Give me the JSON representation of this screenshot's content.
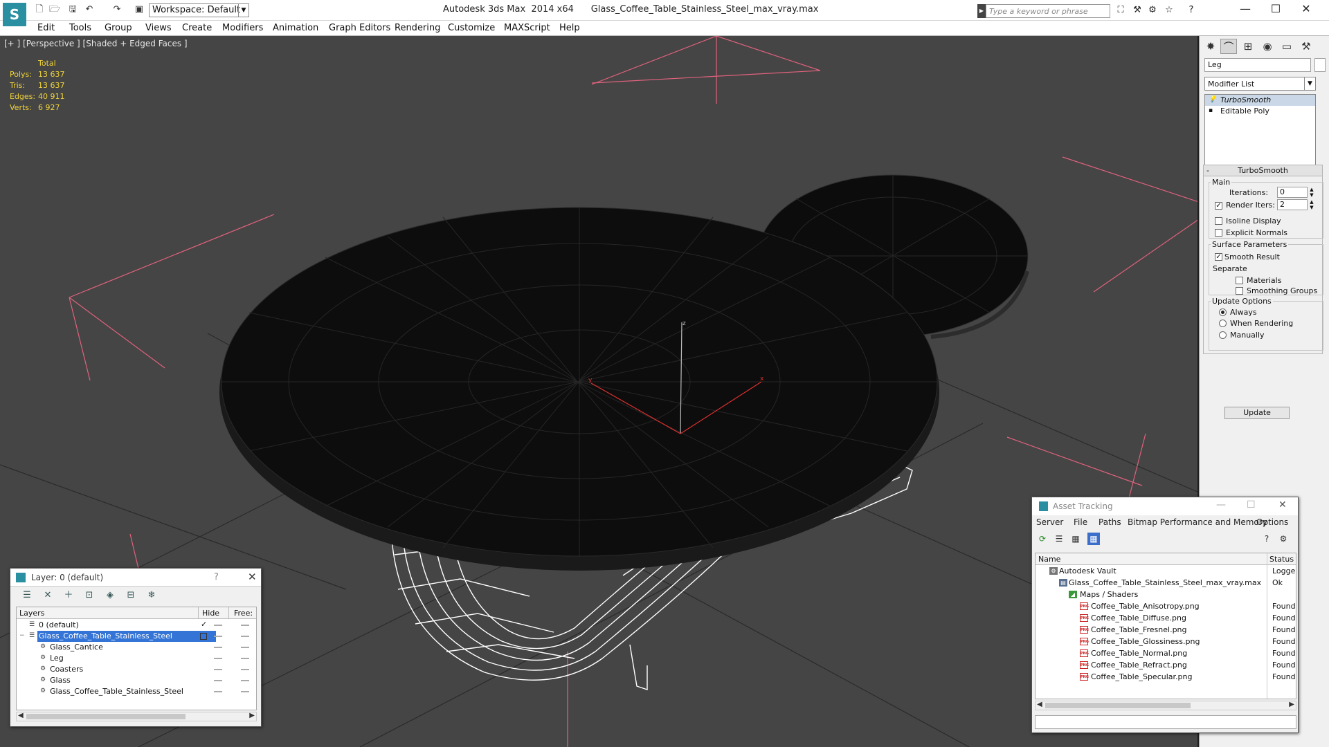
{
  "window": {
    "app_name": "Autodesk 3ds Max  2014 x64",
    "file_name": "Glass_Coffee_Table_Stainless_Steel_max_vray.max",
    "workspace": "Workspace: Default",
    "search_placeholder": "Type a keyword or phrase"
  },
  "menu": [
    "Edit",
    "Tools",
    "Group",
    "Views",
    "Create",
    "Modifiers",
    "Animation",
    "Graph Editors",
    "Rendering",
    "Customize",
    "MAXScript",
    "Help"
  ],
  "viewport": {
    "label": "[+ ] [Perspective ] [Shaded + Edged Faces ]",
    "stats_header": "Total",
    "stats": [
      {
        "label": "Polys:",
        "value": "13 637"
      },
      {
        "label": "Tris:",
        "value": "13 637"
      },
      {
        "label": "Edges:",
        "value": "40 911"
      },
      {
        "label": "Verts:",
        "value": "6 927"
      }
    ],
    "axis_labels": {
      "z": "z",
      "x": "x",
      "y": "y"
    }
  },
  "command_panel": {
    "object_name": "Leg",
    "modifier_list": "Modifier List",
    "stack": [
      {
        "label": "TurboSmooth",
        "selected": true
      },
      {
        "label": "Editable Poly",
        "selected": false
      }
    ],
    "turbosmooth": {
      "title": "TurboSmooth",
      "main_title": "Main",
      "iterations_label": "Iterations:",
      "iterations": "0",
      "render_iters_label": "Render Iters:",
      "render_iters": "2",
      "isoline": "Isoline Display",
      "explicit_normals": "Explicit Normals",
      "surface_title": "Surface Parameters",
      "smooth_result": "Smooth Result",
      "separate": "Separate",
      "materials": "Materials",
      "smoothing_groups": "Smoothing Groups",
      "update_title": "Update Options",
      "always": "Always",
      "when_rendering": "When Rendering",
      "manually": "Manually",
      "update_button": "Update"
    }
  },
  "layer_window": {
    "title": "Layer: 0 (default)",
    "help": "?",
    "columns": [
      "Layers",
      "Hide",
      "Free:"
    ],
    "rows": [
      {
        "name": "0 (default)",
        "level": 0,
        "selected": false
      },
      {
        "name": "Glass_Coffee_Table_Stainless_Steel",
        "level": 0,
        "selected": true
      },
      {
        "name": "Glass_Cantice",
        "level": 1,
        "selected": false
      },
      {
        "name": "Leg",
        "level": 1,
        "selected": false
      },
      {
        "name": "Coasters",
        "level": 1,
        "selected": false
      },
      {
        "name": "Glass",
        "level": 1,
        "selected": false
      },
      {
        "name": "Glass_Coffee_Table_Stainless_Steel",
        "level": 1,
        "selected": false
      }
    ]
  },
  "asset_window": {
    "title": "Asset Tracking",
    "menu": [
      "Server",
      "File",
      "Paths",
      "Bitmap Performance and Memory",
      "Options"
    ],
    "columns": [
      "Name",
      "Status"
    ],
    "rows": [
      {
        "name": "Autodesk Vault",
        "status": "Logged",
        "level": 0,
        "icon": "vault"
      },
      {
        "name": "Glass_Coffee_Table_Stainless_Steel_max_vray.max",
        "status": "Ok",
        "level": 1,
        "icon": "file"
      },
      {
        "name": "Maps / Shaders",
        "status": "",
        "level": 2,
        "icon": "map"
      },
      {
        "name": "Coffee_Table_Anisotropy.png",
        "status": "Found",
        "level": 3,
        "icon": "png"
      },
      {
        "name": "Coffee_Table_Diffuse.png",
        "status": "Found",
        "level": 3,
        "icon": "png"
      },
      {
        "name": "Coffee_Table_Fresnel.png",
        "status": "Found",
        "level": 3,
        "icon": "png"
      },
      {
        "name": "Coffee_Table_Glossiness.png",
        "status": "Found",
        "level": 3,
        "icon": "png"
      },
      {
        "name": "Coffee_Table_Normal.png",
        "status": "Found",
        "level": 3,
        "icon": "png"
      },
      {
        "name": "Coffee_Table_Refract.png",
        "status": "Found",
        "level": 3,
        "icon": "png"
      },
      {
        "name": "Coffee_Table_Specular.png",
        "status": "Found",
        "level": 3,
        "icon": "png"
      }
    ]
  },
  "colors": {
    "viewport_bg": "#454545",
    "stats_text": "#f0d33a",
    "selection_blue": "#3374d6",
    "camera_lines": "#e0627d"
  }
}
